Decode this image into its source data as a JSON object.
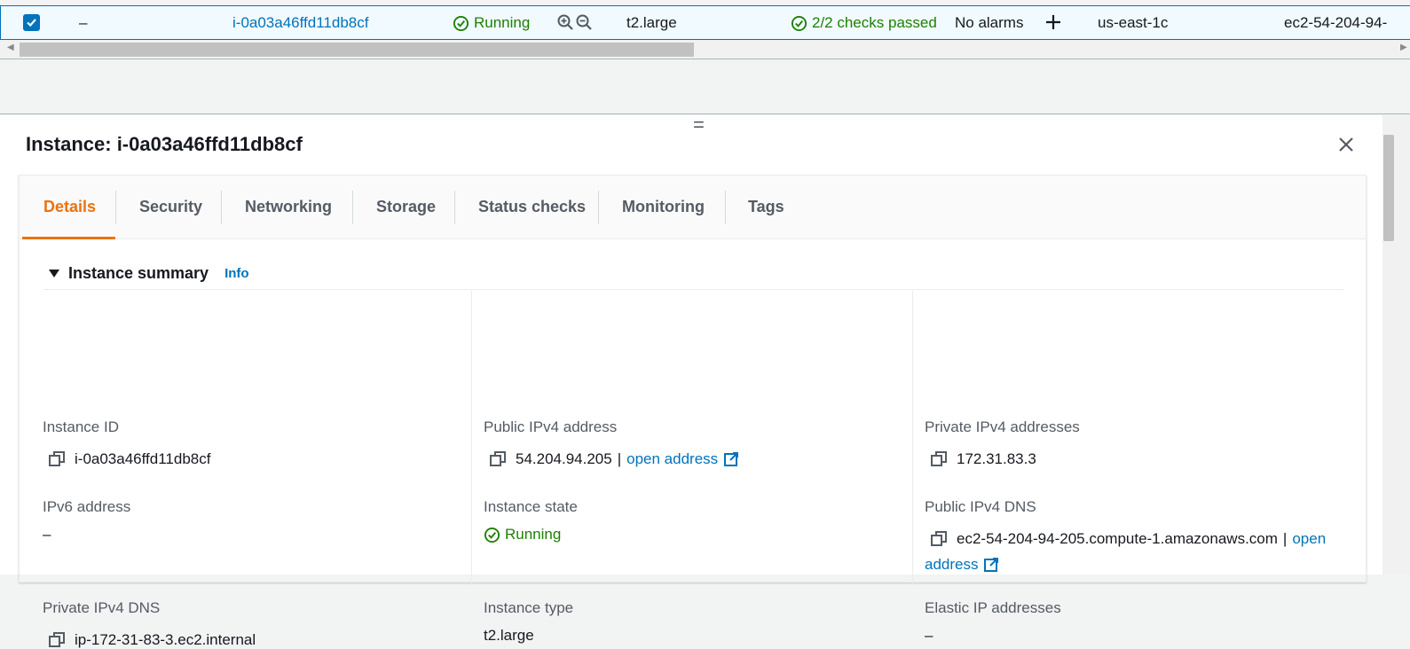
{
  "row": {
    "checked": true,
    "name": "–",
    "instance_id": "i-0a03a46ffd11db8cf",
    "state": "Running",
    "type": "t2.large",
    "checks": "2/2 checks passed",
    "alarms": "No alarms",
    "zone": "us-east-1c",
    "dns": "ec2-54-204-94-"
  },
  "panel": {
    "title": "Instance: i-0a03a46ffd11db8cf",
    "drag_glyph": "="
  },
  "tabs": [
    "Details",
    "Security",
    "Networking",
    "Storage",
    "Status checks",
    "Monitoring",
    "Tags"
  ],
  "summary": {
    "heading": "Instance summary",
    "info": "Info",
    "instance_id_label": "Instance ID",
    "instance_id": "i-0a03a46ffd11db8cf",
    "public_ipv4_label": "Public IPv4 address",
    "public_ipv4": "54.204.94.205",
    "separator": "|",
    "open_address": "open address",
    "private_ipv4_label": "Private IPv4 addresses",
    "private_ipv4": "172.31.83.3",
    "ipv6_label": "IPv6 address",
    "ipv6": "–",
    "state_label": "Instance state",
    "state": "Running",
    "public_dns_label": "Public IPv4 DNS",
    "public_dns": "ec2-54-204-94-205.compute-1.amazonaws.com",
    "open": "open",
    "address": "address",
    "private_dns_label": "Private IPv4 DNS",
    "private_dns": "ip-172-31-83-3.ec2.internal",
    "type_label": "Instance type",
    "type": "t2.large",
    "elastic_label": "Elastic IP addresses",
    "elastic": "–"
  },
  "colors": {
    "accent": "#0073bb",
    "active_tab": "#ec7211",
    "success": "#1d8102"
  },
  "icons": [
    "checkbox-checked-icon",
    "status-ok-icon",
    "zoom-in-icon",
    "zoom-out-icon",
    "plus-icon",
    "close-icon",
    "copy-icon",
    "external-link-icon",
    "caret-down-icon"
  ]
}
